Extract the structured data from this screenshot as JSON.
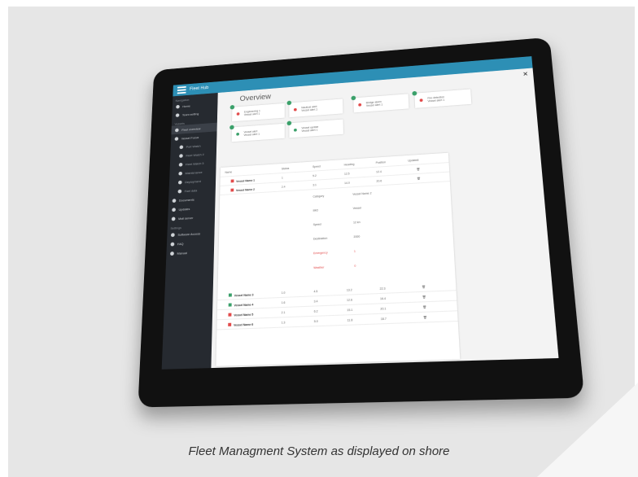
{
  "caption": "Fleet Managment System as displayed on shore",
  "app": {
    "title": "Fleet Hub",
    "accent": "#2d8fb5"
  },
  "page_title": "Overview",
  "sidebar": {
    "sections": [
      {
        "head": "Navigation",
        "items": [
          "Home",
          "Team setting"
        ]
      },
      {
        "head": "Vessels",
        "items": [
          "Fleet overview",
          "Vessel Focus",
          "Port Watch",
          "Fleet Watch 2",
          "Fleet Watch 3",
          "Maintenance",
          "Deployment",
          "Fuel data",
          "Documents",
          "Updates",
          "Mail server"
        ]
      },
      {
        "head": "Settings",
        "items": [
          "Software Access",
          "FAQ",
          "Manual"
        ]
      }
    ]
  },
  "cards": [
    {
      "line1": "Engineering 1",
      "line2": "Vessel alert 1",
      "dot": "#e24a4a"
    },
    {
      "line1": "Nautical alert",
      "line2": "Vessel alert 1",
      "dot": "#e24a4a"
    },
    {
      "line1": "Bridge alarm",
      "line2": "Vessel alert 1",
      "dot": "#e24a4a"
    },
    {
      "line1": "Fire detection",
      "line2": "Vessel alert 1",
      "dot": "#e24a4a"
    },
    {
      "line1": "Vessel alert",
      "line2": "Vessel alert 1",
      "dot": "#3aa06a"
    },
    {
      "line1": "Vessel update",
      "line2": "Vessel alert 1",
      "dot": "#3aa06a"
    }
  ],
  "table": {
    "headers": [
      "Name",
      "Status",
      "Speed",
      "Heading",
      "Position",
      "Updated"
    ],
    "rows": [
      {
        "name": "Vessel Name 1",
        "flag": "#e24a4a",
        "c1": "1",
        "c2": "5.2",
        "c3": "12.5",
        "c4": "12.4",
        "c5": ""
      },
      {
        "name": "Vessel Name 2",
        "flag": "#e24a4a",
        "c1": "2.4",
        "c2": "3.1",
        "c3": "14.0",
        "c4": "20.6",
        "c5": ""
      },
      {
        "name": "Vessel Name 3",
        "flag": "#3aa06a",
        "c1": "1.0",
        "c2": "4.5",
        "c3": "13.2",
        "c4": "22.3",
        "c5": ""
      },
      {
        "name": "Vessel Name 4",
        "flag": "#3aa06a",
        "c1": "1.6",
        "c2": "3.4",
        "c3": "12.6",
        "c4": "16.4",
        "c5": ""
      },
      {
        "name": "Vessel Name 5",
        "flag": "#e24a4a",
        "c1": "2.1",
        "c2": "6.2",
        "c3": "15.1",
        "c4": "20.1",
        "c5": ""
      },
      {
        "name": "Vessel Name 6",
        "flag": "#e24a4a",
        "c1": "1.3",
        "c2": "5.0",
        "c3": "11.8",
        "c4": "18.7",
        "c5": ""
      }
    ]
  },
  "detail": [
    {
      "k": "Category",
      "v": "Vessel Name 2",
      "red": false
    },
    {
      "k": "IMO",
      "v": "Vessel",
      "red": false
    },
    {
      "k": "Speed",
      "v": "12 kn",
      "red": false
    },
    {
      "k": "Destination",
      "v": "2000",
      "red": false
    },
    {
      "k": "Emergency",
      "v": "1",
      "red": true
    },
    {
      "k": "Weather",
      "v": "0",
      "red": true
    }
  ]
}
